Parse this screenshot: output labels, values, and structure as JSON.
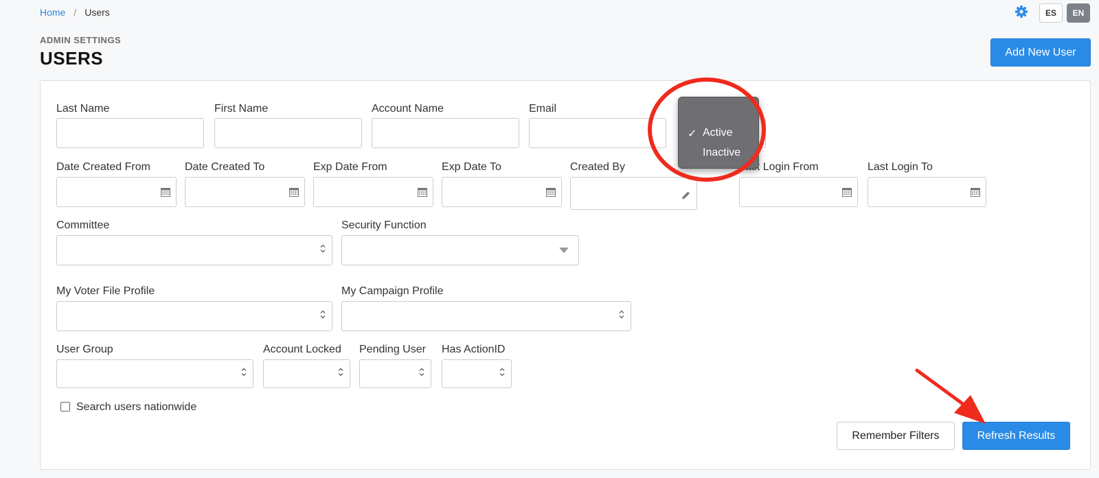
{
  "breadcrumb": {
    "home": "Home",
    "separator": "/",
    "current": "Users"
  },
  "header": {
    "gear_icon": "gear-icon",
    "languages": [
      "ES",
      "EN"
    ],
    "active_language": "EN",
    "subtitle": "ADMIN SETTINGS",
    "title": "USERS",
    "add_user_label": "Add New User"
  },
  "filters": {
    "last_name": {
      "label": "Last Name",
      "value": ""
    },
    "first_name": {
      "label": "First Name",
      "value": ""
    },
    "account_name": {
      "label": "Account Name",
      "value": ""
    },
    "email": {
      "label": "Email",
      "value": ""
    },
    "date_created_from": {
      "label": "Date Created From",
      "value": ""
    },
    "date_created_to": {
      "label": "Date Created To",
      "value": ""
    },
    "exp_date_from": {
      "label": "Exp Date From",
      "value": ""
    },
    "exp_date_to": {
      "label": "Exp Date To",
      "value": ""
    },
    "created_by": {
      "label": "Created By",
      "value": ""
    },
    "last_login_from": {
      "label": "Last Login From",
      "value": ""
    },
    "last_login_to": {
      "label": "Last Login To",
      "value": ""
    },
    "committee": {
      "label": "Committee",
      "value": ""
    },
    "security_function": {
      "label": "Security Function",
      "value": ""
    },
    "my_voter_file_profile": {
      "label": "My Voter File Profile",
      "value": ""
    },
    "my_campaign_profile": {
      "label": "My Campaign Profile",
      "value": ""
    },
    "user_group": {
      "label": "User Group",
      "value": ""
    },
    "account_locked": {
      "label": "Account Locked",
      "value": ""
    },
    "pending_user": {
      "label": "Pending User",
      "value": ""
    },
    "has_actionid": {
      "label": "Has ActionID",
      "value": ""
    },
    "search_nationwide": {
      "label": "Search users nationwide",
      "checked": false
    }
  },
  "status_dropdown": {
    "options": [
      "Active",
      "Inactive"
    ],
    "selected": "Active",
    "check_glyph": "✓"
  },
  "actions": {
    "remember_label": "Remember Filters",
    "refresh_label": "Refresh Results"
  },
  "annotations": {
    "ring_color": "#ee2b1d",
    "arrow_color": "#ee2b1d"
  },
  "colors": {
    "primary": "#2a8be6",
    "link": "#2e86de",
    "lang_active_bg": "#7d8289"
  }
}
